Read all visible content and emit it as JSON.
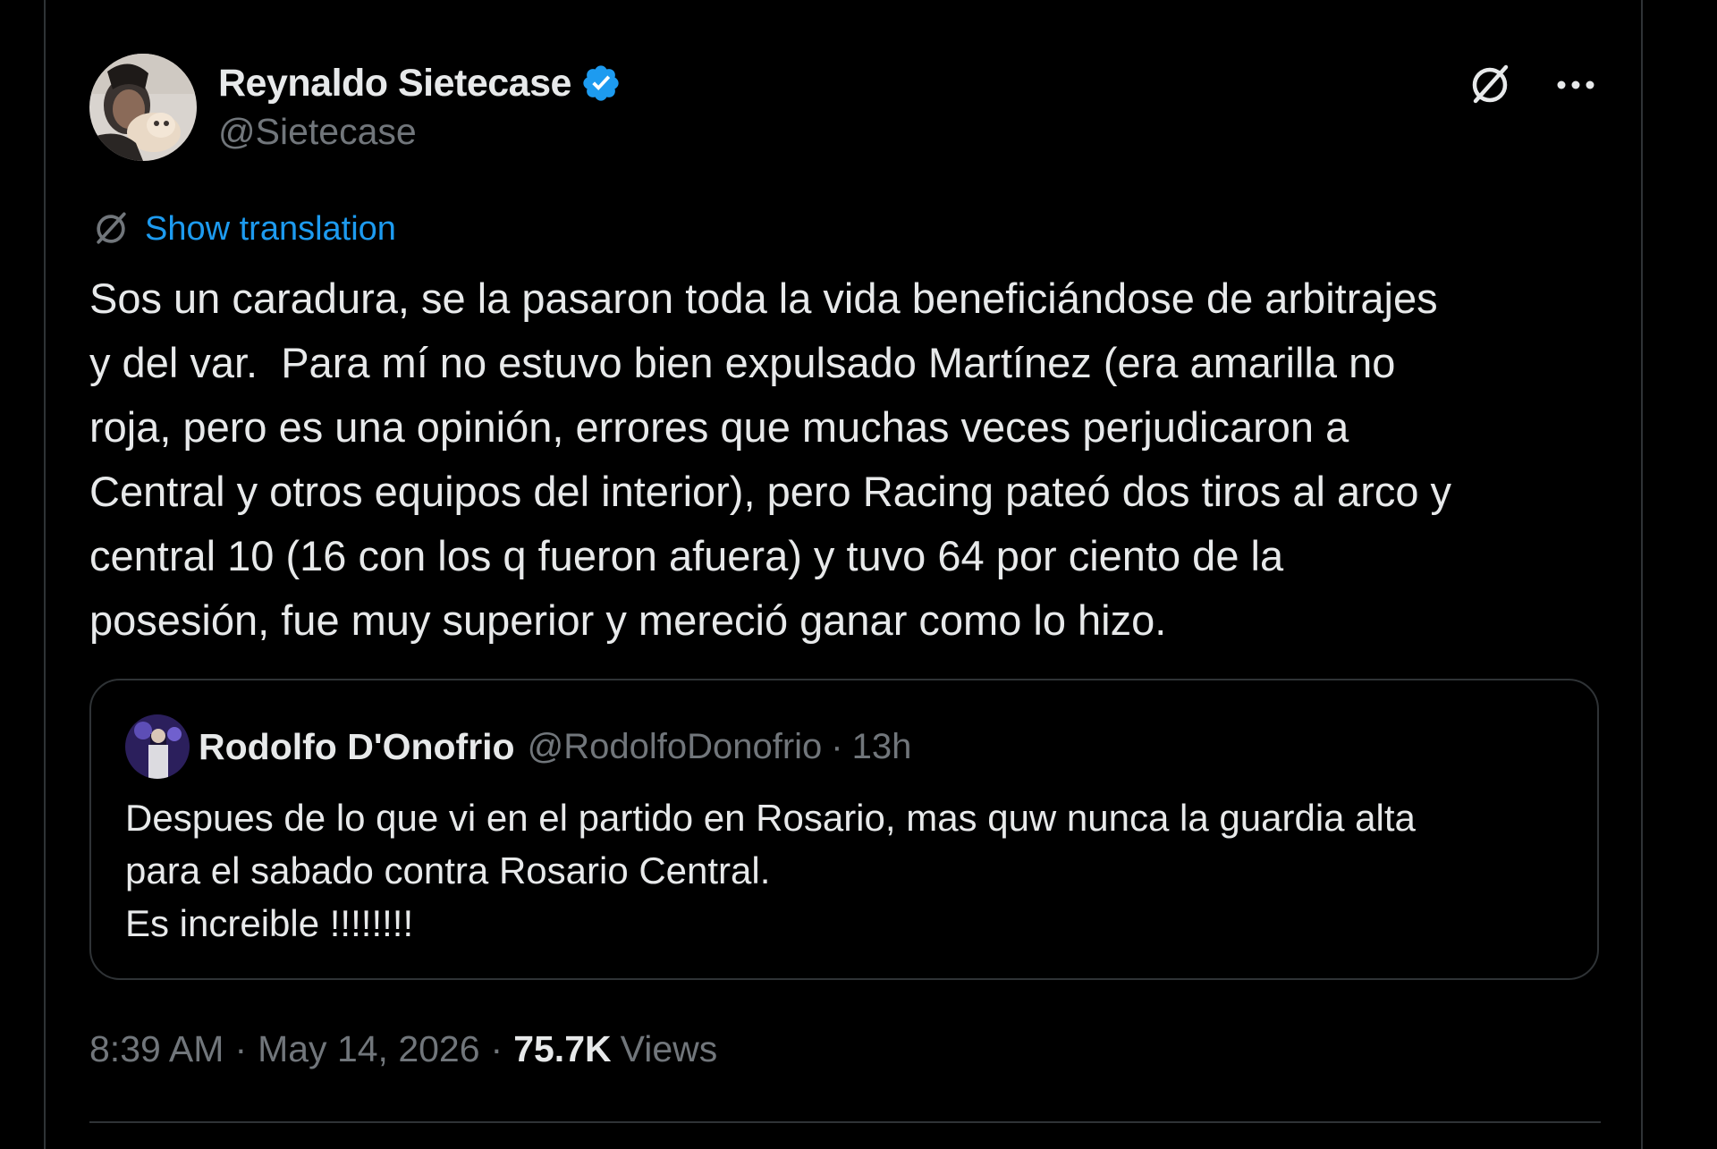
{
  "author": {
    "display_name": "Reynaldo Sietecase",
    "handle": "@Sietecase"
  },
  "actions": {
    "grok_icon": "grok-icon",
    "more_icon": "more-icon"
  },
  "translation": {
    "label": "Show translation"
  },
  "tweet": {
    "text": "Sos un caradura, se la pasaron toda la vida beneficiándose de arbitrajes\ny del var.  Para mí no estuvo bien expulsado Martínez (era amarilla no\nroja, pero es una opinión, errores que muchas veces perjudicaron a\nCentral y otros equipos del interior), pero Racing pateó dos tiros al arco y\ncentral 10 (16 con los q fueron afuera) y tuvo 64 por ciento de la\nposesión, fue muy superior y mereció ganar como lo hizo."
  },
  "quoted": {
    "display_name": "Rodolfo D'Onofrio",
    "handle": "@RodolfoDonofrio",
    "separator": "·",
    "time": "13h",
    "text": "Despues de lo que vi en el partido en Rosario, mas quw nunca la guardia alta\npara el sabado contra Rosario Central.\nEs increible !!!!!!!!"
  },
  "meta": {
    "time": "8:39 AM",
    "sep1": "·",
    "date": "May 14, 2026",
    "sep2": "·",
    "views_count": "75.7K",
    "views_label": "Views"
  },
  "colors": {
    "background": "#000000",
    "text": "#e7e9ea",
    "secondary": "#71767b",
    "accent": "#1d9bf0",
    "border": "#2f3336"
  }
}
